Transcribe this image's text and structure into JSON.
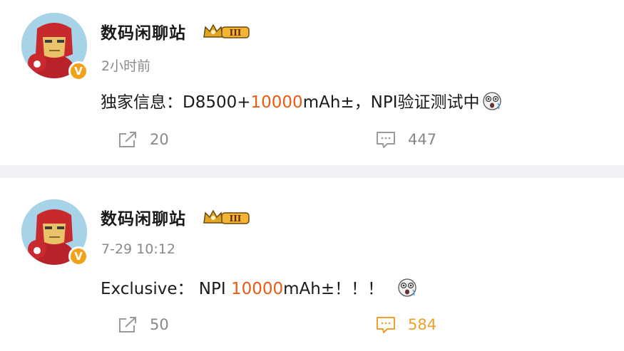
{
  "posts": [
    {
      "username": "数码闲聊站",
      "badge_level": "III",
      "verified_mark": "V",
      "time": "2小时前",
      "content": {
        "prefix": "独家信息：D8500+",
        "highlight": "10000",
        "suffix": "mAh±，NPI验证测试中"
      },
      "reposts": "20",
      "comments": "447",
      "comment_active": false
    },
    {
      "username": "数码闲聊站",
      "badge_level": "III",
      "verified_mark": "V",
      "time": "7-29 10:12",
      "content": {
        "prefix": "Exclusive： NPI ",
        "highlight": "10000",
        "suffix": "mAh±！！！"
      },
      "reposts": "50",
      "comments": "584",
      "comment_active": true
    }
  ],
  "colors": {
    "highlight": "#eb5b12",
    "comment_active": "#f0a02a",
    "verified": "#f4a11a",
    "divider": "#f1f2f5"
  },
  "icons": [
    "iron-man-avatar",
    "verified-v-badge",
    "crown-level-badge",
    "surprised-emoji",
    "repost-icon",
    "comment-icon"
  ]
}
